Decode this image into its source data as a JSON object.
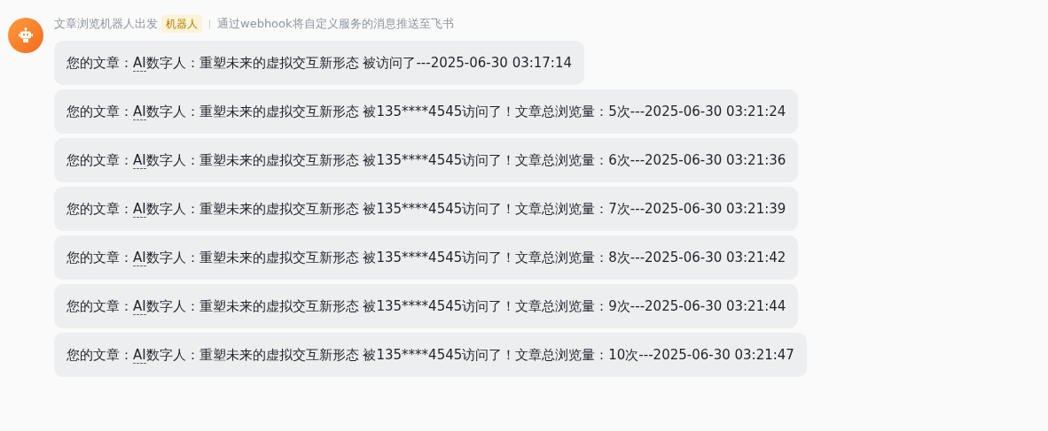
{
  "sender": {
    "name": "文章浏览机器人出发",
    "badge": "机器人",
    "description": "通过webhook将自定义服务的消息推送至飞书"
  },
  "messages": [
    {
      "prefix": "您的文章：",
      "term": "AI",
      "rest": "数字人：重塑未来的虚拟交互新形态 被访问了---2025-06-30 03:17:14"
    },
    {
      "prefix": "您的文章：",
      "term": "AI",
      "rest": "数字人：重塑未来的虚拟交互新形态 被135****4545访问了！文章总浏览量：5次---2025-06-30 03:21:24"
    },
    {
      "prefix": "您的文章：",
      "term": "AI",
      "rest": "数字人：重塑未来的虚拟交互新形态 被135****4545访问了！文章总浏览量：6次---2025-06-30 03:21:36"
    },
    {
      "prefix": "您的文章：",
      "term": "AI",
      "rest": "数字人：重塑未来的虚拟交互新形态 被135****4545访问了！文章总浏览量：7次---2025-06-30 03:21:39"
    },
    {
      "prefix": "您的文章：",
      "term": "AI",
      "rest": "数字人：重塑未来的虚拟交互新形态 被135****4545访问了！文章总浏览量：8次---2025-06-30 03:21:42"
    },
    {
      "prefix": "您的文章：",
      "term": "AI",
      "rest": "数字人：重塑未来的虚拟交互新形态 被135****4545访问了！文章总浏览量：9次---2025-06-30 03:21:44"
    },
    {
      "prefix": "您的文章：",
      "term": "AI",
      "rest": "数字人：重塑未来的虚拟交互新形态 被135****4545访问了！文章总浏览量：10次---2025-06-30 03:21:47"
    }
  ]
}
